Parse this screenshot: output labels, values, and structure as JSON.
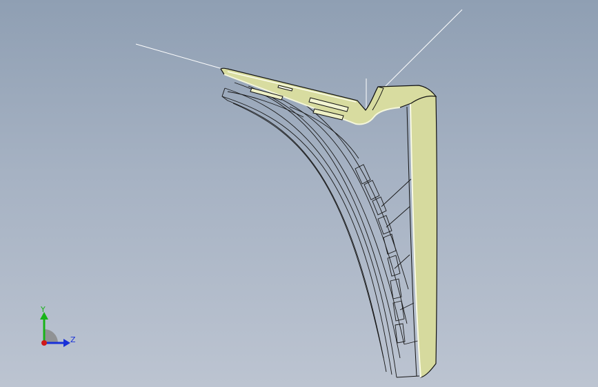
{
  "viewport": {
    "background_top": "#8f9fb3",
    "background_bottom": "#bcc4d1"
  },
  "model": {
    "fill_color": "#d8dca0",
    "edge_color": "#0d0d0d",
    "highlight_color": "#f4f6dc",
    "wire_color": "#ffffff"
  },
  "triad": {
    "y_label": "Y",
    "z_label": "Z",
    "y_color": "#18b418",
    "z_color": "#1830d8",
    "x_color": "#d01818"
  }
}
